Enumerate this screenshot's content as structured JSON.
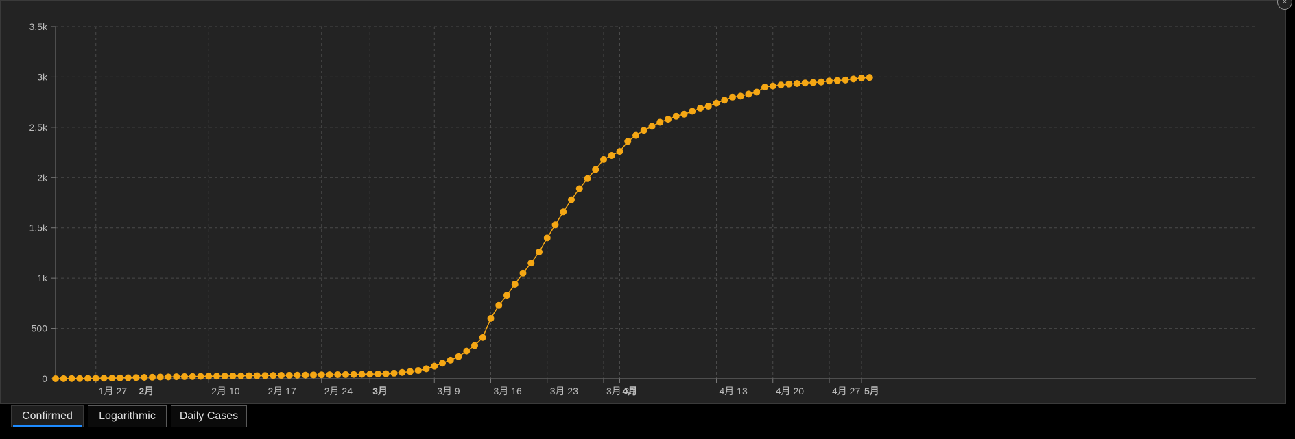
{
  "colors": {
    "background": "#232323",
    "grid": "#4a4a4a",
    "axis": "#7a7a7a",
    "tick_text": "#bdbdbd",
    "series": "#f5a714",
    "tab_accent": "#1e8bff"
  },
  "tabs": [
    {
      "label": "Confirmed",
      "active": true
    },
    {
      "label": "Logarithmic",
      "active": false
    },
    {
      "label": "Daily Cases",
      "active": false
    }
  ],
  "corner_icon": "collapse-icon",
  "chart_data": {
    "type": "line",
    "title": "",
    "xlabel": "",
    "ylabel": "",
    "grid": true,
    "legend": "none",
    "x_start": "2020-01-22",
    "x_range": [
      "2020-01-22",
      "2020-05-03"
    ],
    "ylim": [
      0,
      3500
    ],
    "y_ticks": [
      {
        "value": 0,
        "label": "0"
      },
      {
        "value": 500,
        "label": "500"
      },
      {
        "value": 1000,
        "label": "1k"
      },
      {
        "value": 1500,
        "label": "1.5k"
      },
      {
        "value": 2000,
        "label": "2k"
      },
      {
        "value": 2500,
        "label": "2.5k"
      },
      {
        "value": 3000,
        "label": "3k"
      },
      {
        "value": 3500,
        "label": "3.5k"
      }
    ],
    "x_ticks": [
      {
        "date": "2020-01-27",
        "label": "1月 27",
        "bold": false
      },
      {
        "date": "2020-02-01",
        "label": "2月",
        "bold": true
      },
      {
        "date": "2020-02-10",
        "label": "2月 10",
        "bold": false
      },
      {
        "date": "2020-02-17",
        "label": "2月 17",
        "bold": false
      },
      {
        "date": "2020-02-24",
        "label": "2月 24",
        "bold": false
      },
      {
        "date": "2020-03-01",
        "label": "3月",
        "bold": true
      },
      {
        "date": "2020-03-09",
        "label": "3月 9",
        "bold": false
      },
      {
        "date": "2020-03-16",
        "label": "3月 16",
        "bold": false
      },
      {
        "date": "2020-03-23",
        "label": "3月 23",
        "bold": false
      },
      {
        "date": "2020-03-30",
        "label": "3月 30",
        "bold": false
      },
      {
        "date": "2020-04-01",
        "label": "4月",
        "bold": true
      },
      {
        "date": "2020-04-13",
        "label": "4月 13",
        "bold": false
      },
      {
        "date": "2020-04-20",
        "label": "4月 20",
        "bold": false
      },
      {
        "date": "2020-04-27",
        "label": "4月 27",
        "bold": false
      },
      {
        "date": "2020-05-01",
        "label": "5月",
        "bold": true
      }
    ],
    "series": [
      {
        "values": [
          0,
          1,
          2,
          2,
          3,
          4,
          5,
          6,
          8,
          10,
          12,
          14,
          15,
          17,
          18,
          20,
          21,
          22,
          24,
          25,
          26,
          27,
          28,
          29,
          30,
          31,
          32,
          33,
          34,
          35,
          36,
          37,
          38,
          39,
          40,
          41,
          42,
          43,
          44,
          46,
          48,
          50,
          55,
          63,
          72,
          82,
          100,
          125,
          155,
          185,
          220,
          275,
          330,
          410,
          600,
          730,
          830,
          940,
          1050,
          1150,
          1260,
          1400,
          1530,
          1660,
          1780,
          1890,
          1990,
          2080,
          2180,
          2220,
          2260,
          2360,
          2420,
          2470,
          2510,
          2550,
          2580,
          2610,
          2630,
          2660,
          2690,
          2710,
          2740,
          2770,
          2800,
          2810,
          2830,
          2850,
          2900,
          2910,
          2920,
          2930,
          2935,
          2940,
          2945,
          2950,
          2960,
          2965,
          2970,
          2980,
          2990,
          2995
        ]
      }
    ]
  }
}
